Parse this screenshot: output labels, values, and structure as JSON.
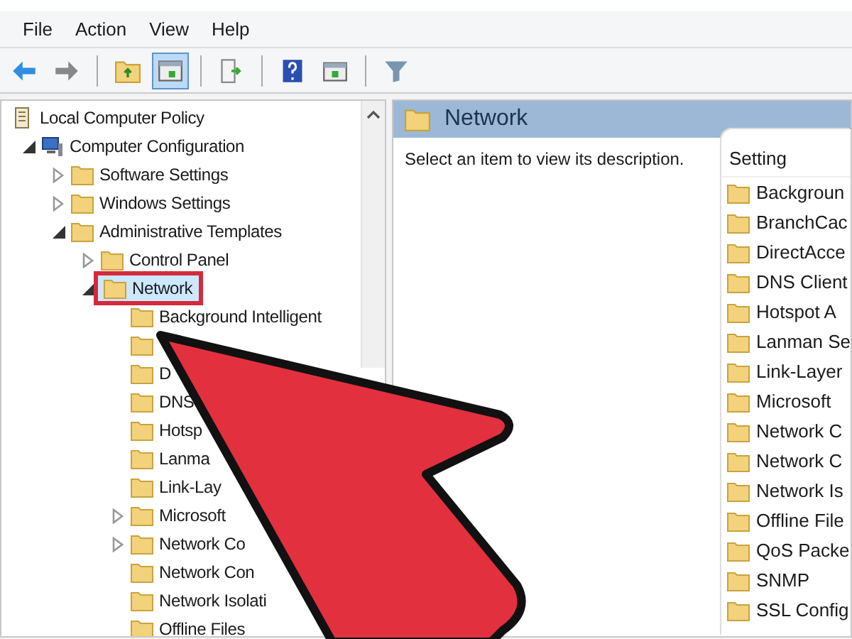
{
  "menu": [
    "File",
    "Action",
    "View",
    "Help"
  ],
  "toolbar": [
    {
      "kind": "back",
      "pressed": false
    },
    {
      "kind": "forward",
      "pressed": false
    },
    {
      "kind": "separator"
    },
    {
      "kind": "up",
      "pressed": false
    },
    {
      "kind": "tree",
      "pressed": true
    },
    {
      "kind": "separator"
    },
    {
      "kind": "export",
      "pressed": false
    },
    {
      "kind": "separator"
    },
    {
      "kind": "help",
      "pressed": false
    },
    {
      "kind": "window",
      "pressed": false
    },
    {
      "kind": "separator"
    },
    {
      "kind": "filter",
      "pressed": false
    }
  ],
  "tree": [
    {
      "label": "Local Computer Policy",
      "kind": "policy",
      "selected": false,
      "outlined": false,
      "children": [
        {
          "label": "Computer Configuration",
          "kind": "computer",
          "expanded": true,
          "selected": false,
          "outlined": false,
          "children": [
            {
              "label": "Software Settings",
              "kind": "folder",
              "expanded": false,
              "selected": false,
              "outlined": false
            },
            {
              "label": "Windows Settings",
              "kind": "folder",
              "expanded": false,
              "selected": false,
              "outlined": false
            },
            {
              "label": "Administrative Templates",
              "kind": "folder",
              "expanded": true,
              "selected": false,
              "outlined": false,
              "children": [
                {
                  "label": "Control Panel",
                  "kind": "folder",
                  "expanded": false,
                  "selected": false,
                  "outlined": false
                },
                {
                  "label": "Network",
                  "kind": "folder",
                  "expanded": true,
                  "selected": true,
                  "outlined": true,
                  "children": [
                    {
                      "label": "Background Intelligent",
                      "kind": "folder",
                      "selected": false,
                      "outlined": false
                    },
                    {
                      "kind": "folder",
                      "selected": false,
                      "outlined": false
                    },
                    {
                      "label": "D",
                      "kind": "folder",
                      "selected": false,
                      "outlined": false
                    },
                    {
                      "label": "DNS",
                      "kind": "folder",
                      "selected": false,
                      "outlined": false
                    },
                    {
                      "label": "Hotsp",
                      "kind": "folder",
                      "selected": false,
                      "outlined": false
                    },
                    {
                      "label": "Lanma",
                      "kind": "folder",
                      "selected": false,
                      "outlined": false
                    },
                    {
                      "label": "Link-Lay",
                      "kind": "folder",
                      "selected": false,
                      "outlined": false
                    },
                    {
                      "label": "Microsoft",
                      "kind": "folder",
                      "expanded": false,
                      "selected": false,
                      "outlined": false
                    },
                    {
                      "label": "Network Co",
                      "kind": "folder",
                      "expanded": false,
                      "selected": false,
                      "outlined": false
                    },
                    {
                      "label": "Network Con",
                      "kind": "folder",
                      "selected": false,
                      "outlined": false
                    },
                    {
                      "label": "Network Isolati",
                      "kind": "folder",
                      "selected": false,
                      "outlined": false
                    },
                    {
                      "label": "Offline Files",
                      "kind": "folder",
                      "selected": false,
                      "outlined": false
                    }
                  ]
                }
              ]
            }
          ]
        }
      ]
    }
  ],
  "details": {
    "title": "Network",
    "description": "Select an item to view its description.",
    "column": "Setting",
    "items": [
      "Backgroun",
      "BranchCac",
      "DirectAcce",
      "DNS Client",
      "Hotspot A",
      "Lanman Se",
      "Link-Layer",
      "Microsoft",
      "Network C",
      "Network C",
      "Network Is",
      "Offline File",
      "QoS Packe",
      "SNMP",
      "SSL Config"
    ]
  }
}
